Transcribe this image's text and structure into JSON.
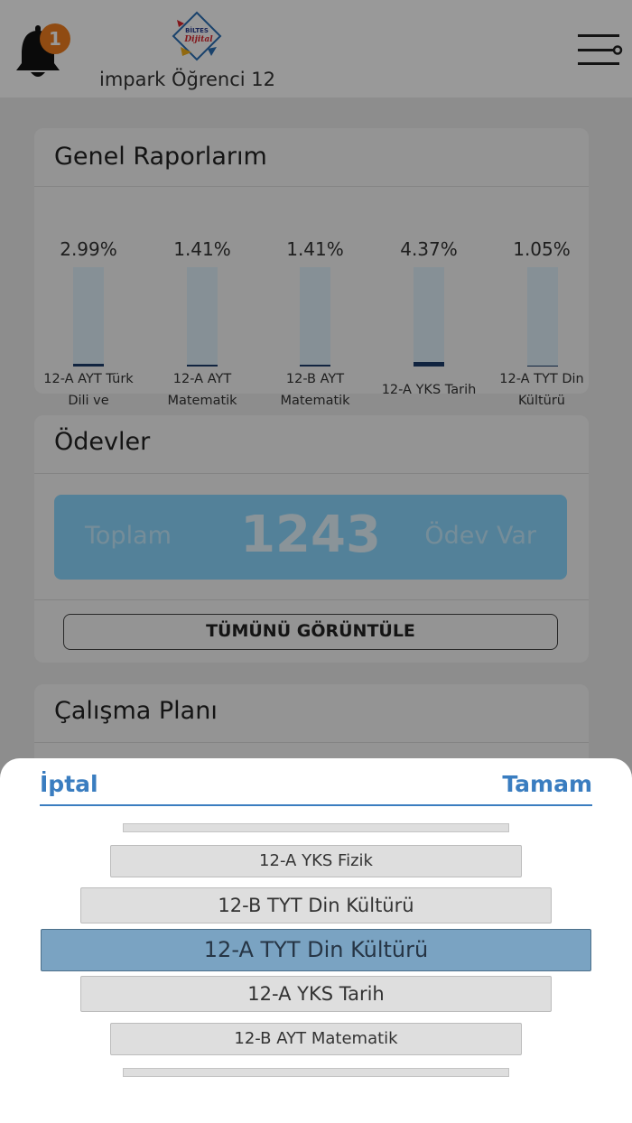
{
  "header": {
    "notification_count": "1",
    "user_name": "impark Öğrenci 12",
    "logo_text_top": "BİLTES",
    "logo_text_bottom": "Dijital"
  },
  "reports": {
    "title": "Genel Raporlarım",
    "items": [
      {
        "percent": "2.99%",
        "value": 2.99,
        "label": "12-A AYT Türk Dili ve"
      },
      {
        "percent": "1.41%",
        "value": 1.41,
        "label": "12-A AYT Matematik"
      },
      {
        "percent": "1.41%",
        "value": 1.41,
        "label": "12-B AYT Matematik"
      },
      {
        "percent": "4.37%",
        "value": 4.37,
        "label": "12-A YKS Tarih"
      },
      {
        "percent": "1.05%",
        "value": 1.05,
        "label": "12-A TYT Din Kültürü"
      }
    ]
  },
  "homework": {
    "title": "Ödevler",
    "total_label": "Toplam",
    "total_count": "1243",
    "suffix_label": "Ödev Var",
    "view_all": "TÜMÜNÜ GÖRÜNTÜLE"
  },
  "study_plan": {
    "title": "Çalışma Planı"
  },
  "picker": {
    "cancel": "İptal",
    "done": "Tamam",
    "options": [
      "12-A YKS Fizik",
      "12-B TYT Din Kültürü",
      "12-A TYT Din Kültürü",
      "12-A YKS Tarih",
      "12-B AYT Matematik"
    ],
    "selected": "12-A TYT Din Kültürü"
  },
  "colors": {
    "accent": "#3a7dc0",
    "badge": "#f07e1e",
    "selected_option": "#7aa3c2",
    "homework_box": "#8ad7ff",
    "bar_fill": "#1d3d6b"
  }
}
